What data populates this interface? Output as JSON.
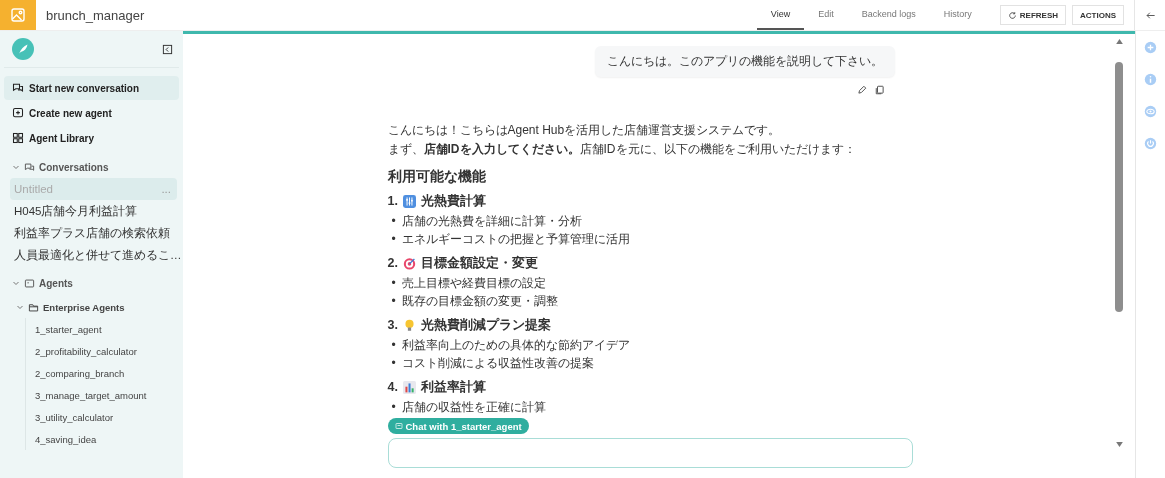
{
  "app": {
    "title": "brunch_manager"
  },
  "tabs": [
    {
      "label": "View",
      "selected": true
    },
    {
      "label": "Edit",
      "selected": false
    },
    {
      "label": "Backend logs",
      "selected": false
    },
    {
      "label": "History",
      "selected": false
    }
  ],
  "toolbar_buttons": [
    {
      "label": "REFRESH",
      "kind": "refresh"
    },
    {
      "label": "ACTIONS",
      "kind": "plain"
    }
  ],
  "sidebar": {
    "actions": [
      {
        "label": "Start new conversation",
        "kind": "chat",
        "selected": true
      },
      {
        "label": "Create new agent",
        "kind": "agent",
        "selected": false
      },
      {
        "label": "Agent Library",
        "kind": "library",
        "selected": false
      }
    ],
    "conversations": {
      "label": "Conversations",
      "expanded": true,
      "items": [
        {
          "label": "Untitled",
          "selected": true,
          "menu": "..."
        },
        {
          "label": "H045店舗今月利益計算",
          "selected": false
        },
        {
          "label": "利益率プラス店舗の検索依頼",
          "selected": false
        },
        {
          "label": "人員最適化と併せて進めるこ…",
          "selected": false
        }
      ]
    },
    "agents": {
      "label": "Agents",
      "expanded": true,
      "children": [
        {
          "label": "Enterprise Agents",
          "expanded": true,
          "children": [
            {
              "label": "1_starter_agent"
            },
            {
              "label": "2_profitability_calculator"
            },
            {
              "label": "2_comparing_branch"
            },
            {
              "label": "3_manage_target_amount"
            },
            {
              "label": "3_utility_calculator"
            },
            {
              "label": "4_saving_idea"
            }
          ]
        }
      ]
    }
  },
  "chat": {
    "user_message": "こんにちは。このアプリの機能を説明して下さい。",
    "response": {
      "intro": [
        "こんにちは！こちらはAgent Hubを活用した店舗運営支援システムです。",
        "まず、**店舗IDを入力してください。**店舗IDを元に、以下の機能をご利用いただけます："
      ],
      "heading": "利用可能な機能",
      "sections": [
        {
          "number": "1.",
          "kind": "meter",
          "title": "光熱費計算",
          "bullets": [
            {
              "marker": "•",
              "text": "店舗の光熱費を詳細に計算・分析"
            },
            {
              "marker": "•",
              "text": "エネルギーコストの把握と予算管理に活用"
            }
          ]
        },
        {
          "number": "2.",
          "kind": "target",
          "title": "目標金額設定・変更",
          "bullets": [
            {
              "marker": "•",
              "text": "売上目標や経費目標の設定"
            },
            {
              "marker": "•",
              "text": "既存の目標金額の変更・調整"
            }
          ]
        },
        {
          "number": "3.",
          "kind": "bulb",
          "title": "光熱費削減プラン提案",
          "bullets": [
            {
              "marker": "•",
              "text": "利益率向上のための具体的な節約アイデア"
            },
            {
              "marker": "•",
              "text": "コスト削減による収益性改善の提案"
            }
          ]
        },
        {
          "number": "4.",
          "kind": "chart",
          "title": "利益率計算",
          "bullets": [
            {
              "marker": "•",
              "text": "店舗の収益性を正確に計算"
            }
          ]
        }
      ]
    },
    "agent_chip": "Chat with 1_starter_agent"
  }
}
